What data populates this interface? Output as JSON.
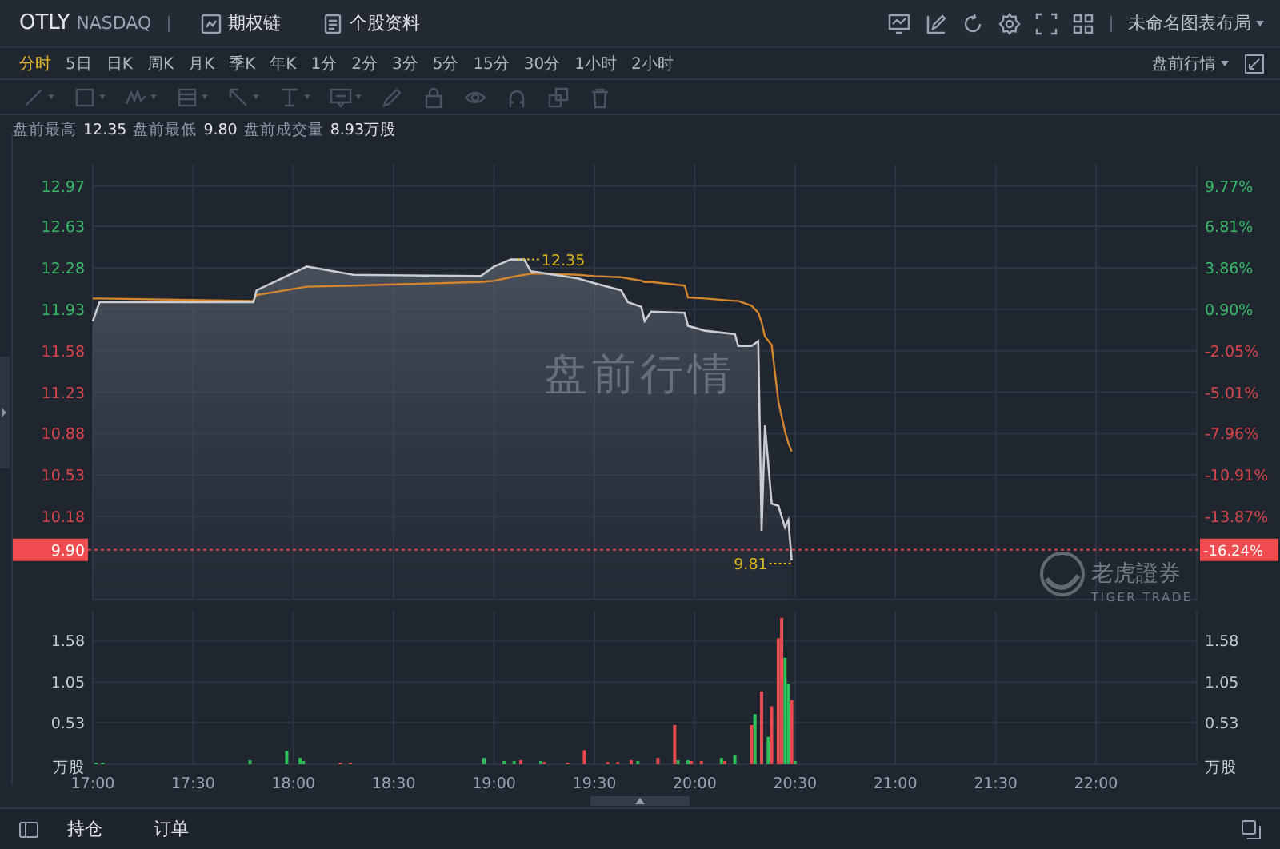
{
  "header": {
    "symbol": "OTLY",
    "exchange": "NASDAQ",
    "links": [
      {
        "kind": "options",
        "label": "期权链"
      },
      {
        "kind": "profile",
        "label": "个股资料"
      }
    ],
    "tools": [
      {
        "kind": "monitor"
      },
      {
        "kind": "edit"
      },
      {
        "kind": "refresh"
      },
      {
        "kind": "settings"
      },
      {
        "kind": "fullscreen"
      },
      {
        "kind": "grid"
      }
    ],
    "layout_menu": "未命名图表布局"
  },
  "periods": [
    {
      "label": "分时",
      "selected": true
    },
    {
      "label": "5日",
      "selected": false
    },
    {
      "label": "日K",
      "selected": false
    },
    {
      "label": "周K",
      "selected": false
    },
    {
      "label": "月K",
      "selected": false
    },
    {
      "label": "季K",
      "selected": false
    },
    {
      "label": "年K",
      "selected": false
    },
    {
      "label": "1分",
      "selected": false
    },
    {
      "label": "2分",
      "selected": false
    },
    {
      "label": "3分",
      "selected": false
    },
    {
      "label": "5分",
      "selected": false
    },
    {
      "label": "15分",
      "selected": false
    },
    {
      "label": "30分",
      "selected": false
    },
    {
      "label": "1小时",
      "selected": false
    },
    {
      "label": "2小时",
      "selected": false
    }
  ],
  "session_menu": "盘前行情",
  "drawing_tools": [
    {
      "kind": "line",
      "dropdown": true,
      "disabled": true
    },
    {
      "kind": "rect",
      "dropdown": true,
      "disabled": true
    },
    {
      "kind": "pattern",
      "dropdown": true,
      "disabled": true
    },
    {
      "kind": "fib",
      "dropdown": true,
      "disabled": true
    },
    {
      "kind": "arrow",
      "dropdown": true,
      "disabled": true
    },
    {
      "kind": "text",
      "dropdown": true,
      "disabled": true
    },
    {
      "kind": "note",
      "dropdown": true,
      "disabled": true
    },
    {
      "kind": "pencil",
      "dropdown": false,
      "disabled": true
    },
    {
      "kind": "lock",
      "dropdown": false,
      "disabled": true
    },
    {
      "kind": "eye",
      "dropdown": false,
      "disabled": true
    },
    {
      "kind": "magnet",
      "dropdown": false,
      "disabled": true
    },
    {
      "kind": "clone",
      "dropdown": false,
      "disabled": true
    },
    {
      "kind": "trash",
      "dropdown": false,
      "disabled": true
    }
  ],
  "stats": [
    {
      "label": "盘前最高",
      "value": "12.35"
    },
    {
      "label": "盘前最低",
      "value": "9.80"
    },
    {
      "label": "盘前成交量",
      "value": "8.93万股"
    }
  ],
  "price_chart": {
    "chart_data": {
      "type": "line",
      "x": [
        1020,
        1022,
        1068,
        1069,
        1084,
        1098,
        1136,
        1140,
        1145,
        1149,
        1151,
        1156,
        1165,
        1170,
        1178,
        1180,
        1184,
        1185,
        1187,
        1197,
        1198,
        1203,
        1212,
        1213,
        1217,
        1219,
        1220,
        1221,
        1223,
        1225,
        1227,
        1228,
        1229
      ],
      "series": [
        {
          "color": "#c9cdd3",
          "values": [
            11.83,
            11.99,
            11.99,
            12.09,
            12.29,
            12.22,
            12.21,
            12.29,
            12.35,
            12.35,
            12.25,
            12.23,
            12.19,
            12.15,
            12.09,
            11.99,
            11.95,
            11.83,
            11.91,
            11.9,
            11.79,
            11.75,
            11.72,
            11.62,
            11.62,
            11.66,
            10.06,
            10.95,
            10.29,
            10.27,
            10.09,
            10.15,
            9.81
          ]
        },
        {
          "color": "#d4862e",
          "values": [
            12.02,
            12.02,
            12.0,
            12.05,
            12.12,
            12.13,
            12.16,
            12.17,
            12.2,
            12.22,
            12.23,
            12.23,
            12.22,
            12.21,
            12.2,
            12.19,
            12.17,
            12.16,
            12.16,
            12.13,
            12.03,
            12.02,
            12.0,
            12.0,
            11.96,
            11.9,
            11.82,
            11.7,
            11.63,
            11.15,
            10.9,
            10.8,
            10.73
          ]
        }
      ],
      "xlim": [
        1020,
        1350
      ],
      "ylim": [
        9.48,
        13.15
      ],
      "grid": true,
      "ref_lines": [
        {
          "axis": "y",
          "value": 9.9,
          "color": "#e0444a",
          "label": "9.90"
        }
      ],
      "yticks": [
        {
          "value": 12.97,
          "label": "12.97"
        },
        {
          "value": 12.63,
          "label": "12.63"
        },
        {
          "value": 12.28,
          "label": "12.28"
        },
        {
          "value": 11.93,
          "label": "11.93"
        },
        {
          "value": 11.58,
          "label": "11.58"
        },
        {
          "value": 11.23,
          "label": "11.23"
        },
        {
          "value": 10.88,
          "label": "10.88"
        },
        {
          "value": 10.53,
          "label": "10.53"
        },
        {
          "value": 10.18,
          "label": "10.18"
        }
      ],
      "annotations": [
        {
          "x": 1147,
          "y": 12.35,
          "text": "12.35"
        },
        {
          "x": 1229,
          "y": 9.81,
          "text": "9.81"
        }
      ]
    },
    "right_axis": [
      {
        "label": "9.77%",
        "color": "#3bb868"
      },
      {
        "label": "6.81%",
        "color": "#3bb868"
      },
      {
        "label": "3.86%",
        "color": "#3bb868"
      },
      {
        "label": "0.90%",
        "color": "#3bb868"
      },
      {
        "label": "-2.05%",
        "color": "#d8454b"
      },
      {
        "label": "-5.01%",
        "color": "#d8454b"
      },
      {
        "label": "-7.96%",
        "color": "#d8454b"
      },
      {
        "label": "-10.91%",
        "color": "#d8454b"
      },
      {
        "label": "-13.87%",
        "color": "#d8454b"
      }
    ],
    "current": {
      "pct_label": "-16.24%"
    },
    "watermark": "盘前行情",
    "brand": {
      "name": "老虎證券",
      "tagline": "TIGER TRADE"
    }
  },
  "volume_chart": {
    "chart_data": {
      "type": "bar",
      "x": [
        1021,
        1023,
        1067,
        1078,
        1082,
        1083,
        1094,
        1097,
        1137,
        1143,
        1146,
        1148,
        1154,
        1155,
        1162,
        1167,
        1174,
        1177,
        1181,
        1183,
        1189,
        1194,
        1195,
        1198,
        1199,
        1202,
        1208,
        1209,
        1212,
        1217,
        1218,
        1220,
        1222,
        1223,
        1225,
        1226,
        1227,
        1228,
        1229,
        1230
      ],
      "series": [
        {
          "color": "#2fbf5b",
          "values": [
            0.02,
            0.02,
            0.05,
            0.17,
            0.08,
            0.04,
            null,
            null,
            0.08,
            0.04,
            0.04,
            null,
            0.04,
            null,
            null,
            null,
            null,
            null,
            null,
            0.04,
            null,
            null,
            0.05,
            0.05,
            null,
            null,
            0.08,
            null,
            0.12,
            null,
            0.64,
            null,
            0.35,
            null,
            null,
            null,
            1.36,
            1.03,
            null,
            0.04
          ]
        },
        {
          "color": "#ea4a4f",
          "values": [
            null,
            null,
            null,
            null,
            null,
            null,
            0.02,
            0.02,
            null,
            null,
            null,
            0.05,
            null,
            0.03,
            0.02,
            0.18,
            0.03,
            0.03,
            0.05,
            null,
            0.08,
            0.5,
            null,
            null,
            0.04,
            0.04,
            null,
            0.04,
            null,
            0.5,
            null,
            0.93,
            null,
            0.74,
            1.61,
            1.87,
            null,
            null,
            0.82,
            null
          ]
        }
      ],
      "xlim": [
        1020,
        1350
      ],
      "ylim": [
        0,
        1.96
      ],
      "grid": true,
      "xticks": [
        {
          "value": 1020,
          "label": "17:00"
        },
        {
          "value": 1050,
          "label": "17:30"
        },
        {
          "value": 1080,
          "label": "18:00"
        },
        {
          "value": 1110,
          "label": "18:30"
        },
        {
          "value": 1140,
          "label": "19:00"
        },
        {
          "value": 1170,
          "label": "19:30"
        },
        {
          "value": 1200,
          "label": "20:00"
        },
        {
          "value": 1230,
          "label": "20:30"
        },
        {
          "value": 1260,
          "label": "21:00"
        },
        {
          "value": 1290,
          "label": "21:30"
        },
        {
          "value": 1320,
          "label": "22:00"
        }
      ],
      "yticks": [
        0.53,
        1.05,
        1.58
      ]
    },
    "right_ticks": [
      "1.58",
      "1.05",
      "0.53"
    ],
    "unit_labels": [
      "万股",
      "万股"
    ]
  },
  "bottom_tabs": [
    {
      "label": "持仓"
    },
    {
      "label": "订单"
    }
  ]
}
